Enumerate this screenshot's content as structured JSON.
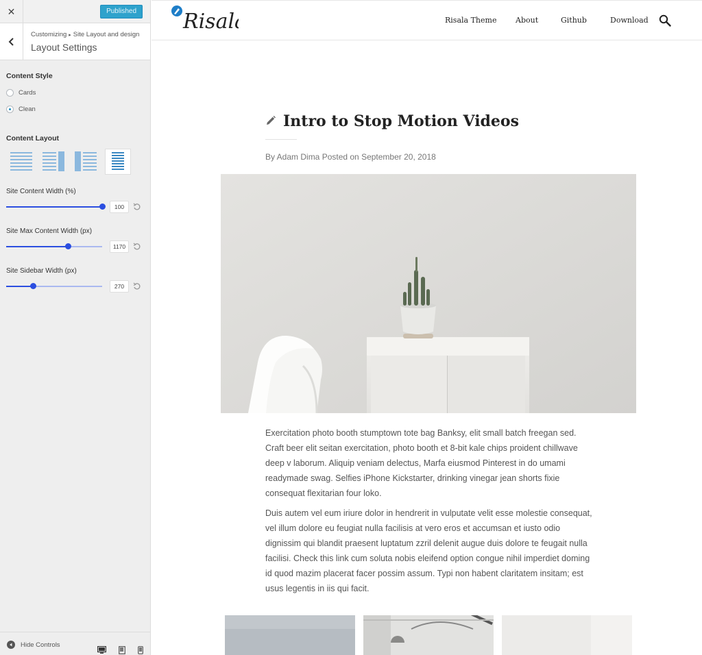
{
  "customizer": {
    "close_icon": "close-icon",
    "publish_label": "Published",
    "breadcrumb": [
      "Customizing",
      "Site Layout and design"
    ],
    "section_title": "Layout Settings",
    "content_style": {
      "title": "Content Style",
      "options": [
        {
          "label": "Cards",
          "checked": false
        },
        {
          "label": "Clean",
          "checked": true
        }
      ]
    },
    "content_layout": {
      "title": "Content Layout",
      "selected_index": 3
    },
    "sliders": [
      {
        "title": "Site Content Width (%)",
        "value": "100",
        "fraction": 1.0
      },
      {
        "title": "Site Max Content Width (px)",
        "value": "1170",
        "fraction": 0.64
      },
      {
        "title": "Site Sidebar Width (px)",
        "value": "270",
        "fraction": 0.28
      }
    ],
    "hide_controls_label": "Hide Controls",
    "device_icons": [
      "desktop-icon",
      "tablet-icon",
      "mobile-icon"
    ]
  },
  "site": {
    "logo_text": "Risala",
    "nav": [
      "Risala Theme",
      "About",
      "Github",
      "Download"
    ],
    "search_icon": "search-icon",
    "post": {
      "title": "Intro to Stop Motion Videos",
      "byline": "By Adam Dima Posted on September 20, 2018",
      "paragraphs": [
        "Exercitation photo booth stumptown tote bag Banksy, elit small batch freegan sed. Craft beer elit seitan exercitation, photo booth et 8-bit kale chips proident chillwave deep v laborum. Aliquip veniam delectus, Marfa eiusmod Pinterest in do umami readymade swag. Selfies iPhone Kickstarter, drinking vinegar jean shorts fixie consequat flexitarian four loko.",
        "Duis autem vel eum iriure dolor in hendrerit in vulputate velit esse molestie consequat, vel illum dolore eu feugiat nulla facilisis at vero eros et accumsan et iusto odio dignissim qui blandit praesent luptatum zzril delenit augue duis dolore te feugait nulla facilisi. Check this link cum soluta nobis eleifend option congue nihil imperdiet doming id quod mazim placerat facer possim assum. Typi non habent claritatem insitam; est usus legentis in iis qui facit."
      ]
    }
  },
  "colors": {
    "accent": "#2b4ee0",
    "publish_button": "#2ea2cc",
    "sidebar_bg": "#eeeeee"
  }
}
